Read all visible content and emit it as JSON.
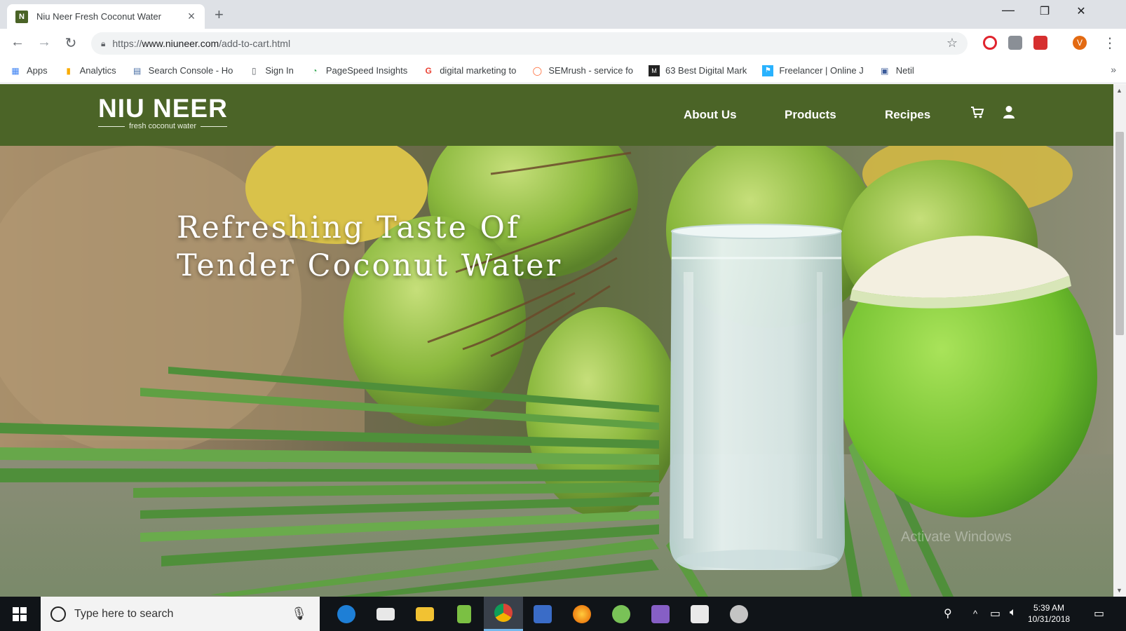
{
  "browser": {
    "tab": {
      "favicon_letter": "N",
      "title": "Niu Neer Fresh Coconut Water",
      "close": "×"
    },
    "new_tab": "+",
    "window_controls": {
      "minimize": "—",
      "restore": "❐",
      "close": "✕"
    },
    "nav": {
      "back": "←",
      "forward": "→",
      "reload": "↻"
    },
    "address": {
      "scheme": "https://",
      "host": "www.niuneer.com",
      "path": "/add-to-cart.html"
    },
    "bookmark_star": "☆",
    "menu_dots": "⋮",
    "profile_initial": "V",
    "bookmarks": [
      {
        "label": "Apps",
        "icon": "apps-grid-icon"
      },
      {
        "label": "Analytics",
        "icon": "analytics-icon"
      },
      {
        "label": "Search Console - Ho",
        "icon": "search-console-icon"
      },
      {
        "label": "Sign In",
        "icon": "page-icon"
      },
      {
        "label": "PageSpeed Insights",
        "icon": "pagespeed-icon"
      },
      {
        "label": "digital marketing to",
        "icon": "google-icon"
      },
      {
        "label": "SEMrush - service fo",
        "icon": "semrush-icon"
      },
      {
        "label": "63 Best Digital Mark",
        "icon": "bookmark-icon"
      },
      {
        "label": "Freelancer | Online J",
        "icon": "freelancer-icon"
      },
      {
        "label": "Netil",
        "icon": "netil-icon"
      }
    ],
    "bookmarks_more": "»"
  },
  "site": {
    "logo": {
      "main": "NIU NEER",
      "sub": "fresh coconut water"
    },
    "nav": [
      "About Us",
      "Products",
      "Recipes"
    ],
    "cart_icon": "shopping-cart-icon",
    "user_icon": "user-icon",
    "hero": {
      "title_line1": "Refreshing Taste Of",
      "title_line2": "Tender Coconut Water"
    },
    "watermark": "Activate Windows"
  },
  "colors": {
    "header_green": "#4b6427",
    "coconut_green": "#8ec63f",
    "leaf_green": "#4f8f3a",
    "water_glass": "#dce9e8"
  },
  "taskbar": {
    "search_placeholder": "Type here to search",
    "apps": [
      "edge-icon",
      "mail-icon",
      "file-explorer-icon",
      "notepad-icon",
      "chrome-icon",
      "remote-desktop-icon",
      "firefox-icon",
      "android-studio-icon",
      "visual-studio-icon",
      "photos-icon",
      "paint-icon"
    ],
    "clock_time": "5:39 AM",
    "clock_date": "10/31/2018"
  }
}
